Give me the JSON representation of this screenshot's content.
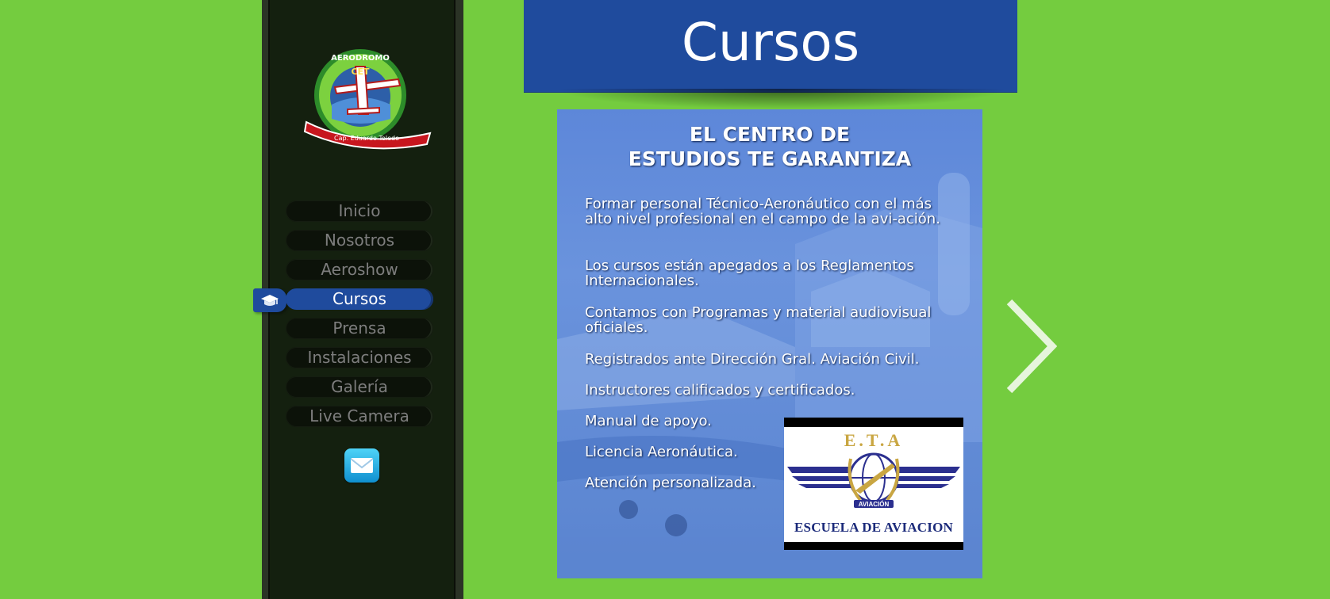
{
  "header": {
    "title": "Cursos"
  },
  "logo": {
    "top_text": "AERODROMO",
    "badge": "CET",
    "ribbon": "Cap. Eduardo Toledo"
  },
  "nav": {
    "items": [
      {
        "label": "Inicio",
        "active": false
      },
      {
        "label": "Nosotros",
        "active": false
      },
      {
        "label": "Aeroshow",
        "active": false
      },
      {
        "label": "Cursos",
        "active": true
      },
      {
        "label": "Prensa",
        "active": false
      },
      {
        "label": "Instalaciones",
        "active": false
      },
      {
        "label": "Galería",
        "active": false
      },
      {
        "label": "Live Camera",
        "active": false
      }
    ],
    "active_icon": "graduation-cap-icon",
    "mail_icon": "envelope-icon"
  },
  "poster": {
    "title_line1": "EL CENTRO DE",
    "title_line2": "ESTUDIOS  TE GARANTIZA",
    "items": [
      "Formar personal Técnico-Aeronáutico con el  más alto nivel profesional en el campo de la avi-ación.",
      "Los cursos están apegados a los Reglamentos Internacionales.",
      "Contamos con Programas y material audiovisual oficiales.",
      "Registrados ante Dirección Gral. Aviación Civil.",
      "Instructores calificados y certificados.",
      "Manual de apoyo.",
      "Licencia Aeronáutica.",
      "Atención personalizada."
    ],
    "school_logo": {
      "letters": "E.T.A",
      "banner": "AVIACIÓN",
      "name": "ESCUELA DE AVIACION"
    }
  },
  "colors": {
    "background": "#74cc3f",
    "accent": "#1f4b9d",
    "sidebar": "#14200f"
  },
  "next_icon": "chevron-right-icon"
}
